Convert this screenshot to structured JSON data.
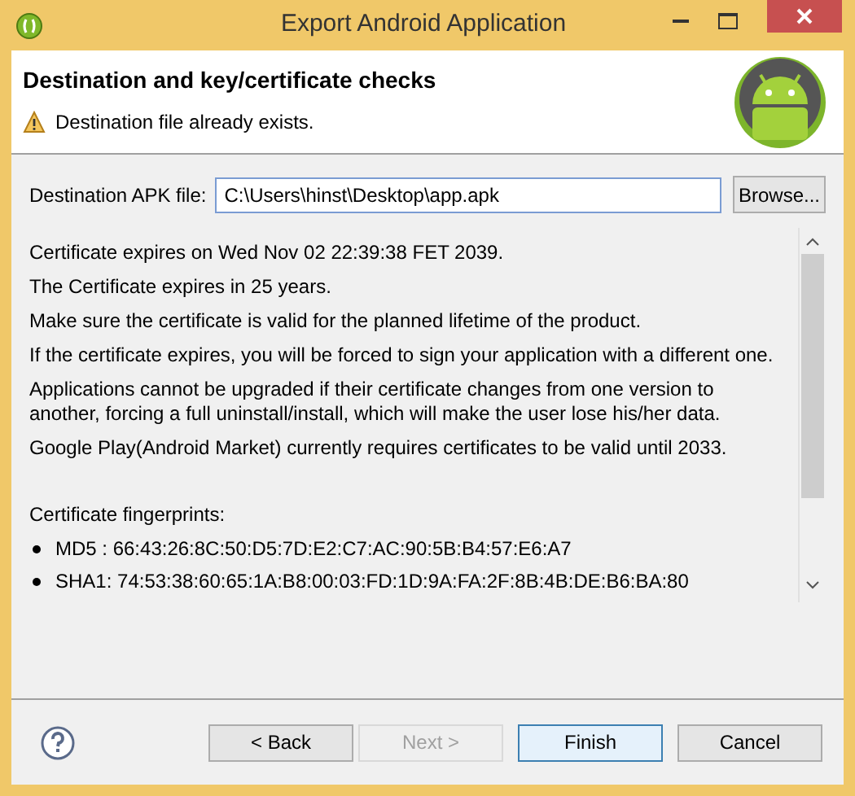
{
  "window": {
    "title": "Export Android Application"
  },
  "header": {
    "title": "Destination and key/certificate checks",
    "message": "Destination file already exists."
  },
  "destination": {
    "label": "Destination APK file:",
    "value": "C:\\Users\\hinst\\Desktop\\app.apk",
    "button": "Browse..."
  },
  "paragraphs": [
    "Certificate expires on Wed Nov 02 22:39:38 FET 2039.",
    "The Certificate expires in 25 years.",
    "Make sure the certificate is valid for the planned lifetime of the product.",
    "If the certificate expires, you will be forced to sign your application with a different one.",
    "Applications cannot be upgraded if their certificate changes from one version to another, forcing a full uninstall/install, which will make the user lose his/her data.",
    "Google Play(Android Market) currently requires certificates to be valid until 2033."
  ],
  "fingerprints": {
    "heading": "Certificate fingerprints:",
    "items": [
      "MD5 : 66:43:26:8C:50:D5:7D:E2:C7:AC:90:5B:B4:57:E6:A7",
      "SHA1: 74:53:38:60:65:1A:B8:00:03:FD:1D:9A:FA:2F:8B:4B:DE:B6:BA:80"
    ]
  },
  "buttons": [
    {
      "label": "< Back",
      "kind": "normal",
      "disabled": false
    },
    {
      "label": "Next >",
      "kind": "normal",
      "disabled": true
    },
    {
      "label": "Finish",
      "kind": "default",
      "disabled": false
    },
    {
      "label": "Cancel",
      "kind": "normal",
      "disabled": false
    }
  ]
}
